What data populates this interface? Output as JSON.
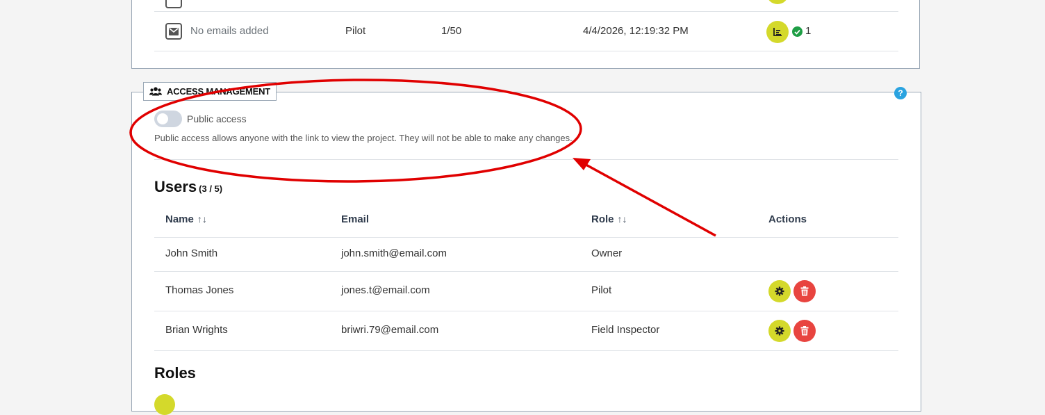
{
  "devices_table": {
    "rows": [
      {
        "email_label": "No emails added",
        "role": "Pilot",
        "count": "1/50",
        "timestamp": "4/4/2026, 12:19:32 PM",
        "status_count": "1"
      }
    ]
  },
  "access": {
    "title": "ACCESS MANAGEMENT",
    "help_symbol": "?",
    "public_access_label": "Public access",
    "public_access_enabled": false,
    "public_access_description": "Public access allows anyone with the link to view the project. They will not be able to make any changes."
  },
  "users": {
    "heading": "Users",
    "count": "(3 / 5)",
    "columns": {
      "name": "Name",
      "email": "Email",
      "role": "Role",
      "actions": "Actions"
    },
    "sort_symbol": "↑↓",
    "rows": [
      {
        "name": "John Smith",
        "email": "john.smith@email.com",
        "role": "Owner"
      },
      {
        "name": "Thomas Jones",
        "email": "jones.t@email.com",
        "role": "Pilot"
      },
      {
        "name": "Brian Wrights",
        "email": "briwri.79@email.com",
        "role": "Field Inspector"
      }
    ]
  },
  "roles": {
    "heading": "Roles"
  },
  "colors": {
    "accent_yellow": "#d4d92b",
    "danger_red": "#e8443f",
    "success_green": "#1e9e45",
    "help_blue": "#2aa3e0",
    "annotation_red": "#e00000"
  }
}
